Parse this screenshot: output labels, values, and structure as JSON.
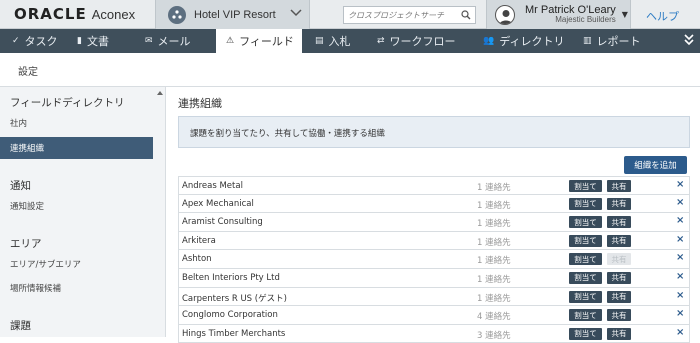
{
  "header": {
    "logo_oracle": "ORACLE",
    "logo_aconex": "Aconex",
    "project_name": "Hotel VIP Resort",
    "search_placeholder": "クロスプロジェクトサーチ",
    "user_name": "Mr Patrick O'Leary",
    "user_org": "Majestic Builders",
    "help_label": "ヘルプ"
  },
  "nav": {
    "items": [
      {
        "label": "タスク",
        "icon": "check-icon"
      },
      {
        "label": "文書",
        "icon": "document-icon"
      },
      {
        "label": "メール",
        "icon": "mail-icon"
      },
      {
        "label": "フィールド",
        "icon": "warning-icon",
        "active": true
      },
      {
        "label": "入札",
        "icon": "tender-icon"
      },
      {
        "label": "ワークフロー",
        "icon": "workflow-icon"
      },
      {
        "label": "ディレクトリ",
        "icon": "people-icon"
      },
      {
        "label": "レポート",
        "icon": "bar-chart-icon"
      }
    ],
    "more_icon": "double-chevron-down-icon"
  },
  "subheader": {
    "title": "設定"
  },
  "sidebar": {
    "sections": [
      {
        "heading": "フィールドディレクトリ",
        "items": [
          "社内",
          "連携組織"
        ]
      },
      {
        "heading": "通知",
        "items": [
          "通知設定"
        ]
      },
      {
        "heading": "エリア",
        "items": [
          "エリア/サブエリア",
          "場所情報候補"
        ]
      },
      {
        "heading": "課題",
        "items": []
      }
    ],
    "active_item": "連携組織"
  },
  "main": {
    "title": "連携組織",
    "info_text": "課題を割り当てたり、共有して協働・連携する組織",
    "add_button": "組織を追加",
    "assign_label": "割当て",
    "share_label": "共有",
    "rows": [
      {
        "name": "Andreas Metal",
        "contacts": "1 連絡先",
        "share_enabled": true
      },
      {
        "name": "Apex Mechanical",
        "contacts": "1 連絡先",
        "share_enabled": true
      },
      {
        "name": "Aramist Consulting",
        "contacts": "1 連絡先",
        "share_enabled": true
      },
      {
        "name": "Arkitera",
        "contacts": "1 連絡先",
        "share_enabled": true
      },
      {
        "name": "Ashton",
        "contacts": "1 連絡先",
        "share_enabled": false
      },
      {
        "name": "Belten Interiors Pty Ltd",
        "contacts": "1 連絡先",
        "share_enabled": true
      },
      {
        "name": "Carpenters R US (ゲスト)",
        "contacts": "1 連絡先",
        "share_enabled": true
      },
      {
        "name": "Conglomo Corporation",
        "contacts": "4 連絡先",
        "share_enabled": true
      },
      {
        "name": "Hings Timber Merchants",
        "contacts": "3 連絡先",
        "share_enabled": true
      }
    ]
  }
}
